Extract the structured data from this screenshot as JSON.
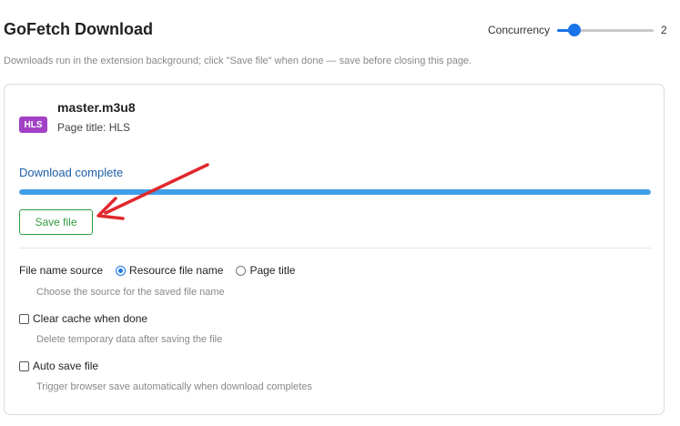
{
  "header": {
    "title": "GoFetch Download",
    "concurrency_label": "Concurrency",
    "concurrency_value": "2",
    "concurrency_fraction": 0.18
  },
  "subtitle": "Downloads run in the extension background; click \"Save file\" when done — save before closing this page.",
  "download": {
    "badge": "HLS",
    "file_name": "master.m3u8",
    "page_title_label": "Page title:",
    "page_title_value": "HLS",
    "status": "Download complete",
    "progress_percent": 100,
    "save_label": "Save file"
  },
  "options": {
    "file_name_source": {
      "label": "File name source",
      "choices": [
        "Resource file name",
        "Page title"
      ],
      "selected": "Resource file name",
      "hint": "Choose the source for the saved file name"
    },
    "clear_cache": {
      "label": "Clear cache when done",
      "checked": false,
      "hint": "Delete temporary data after saving the file"
    },
    "auto_save": {
      "label": "Auto save file",
      "checked": false,
      "hint": "Trigger browser save automatically when download completes"
    }
  },
  "colors": {
    "accent": "#1a73e8",
    "progress": "#3e9fe8",
    "save_green": "#2e9b3e",
    "badge": "#a241c6",
    "annotation_arrow": "#e0282d"
  }
}
